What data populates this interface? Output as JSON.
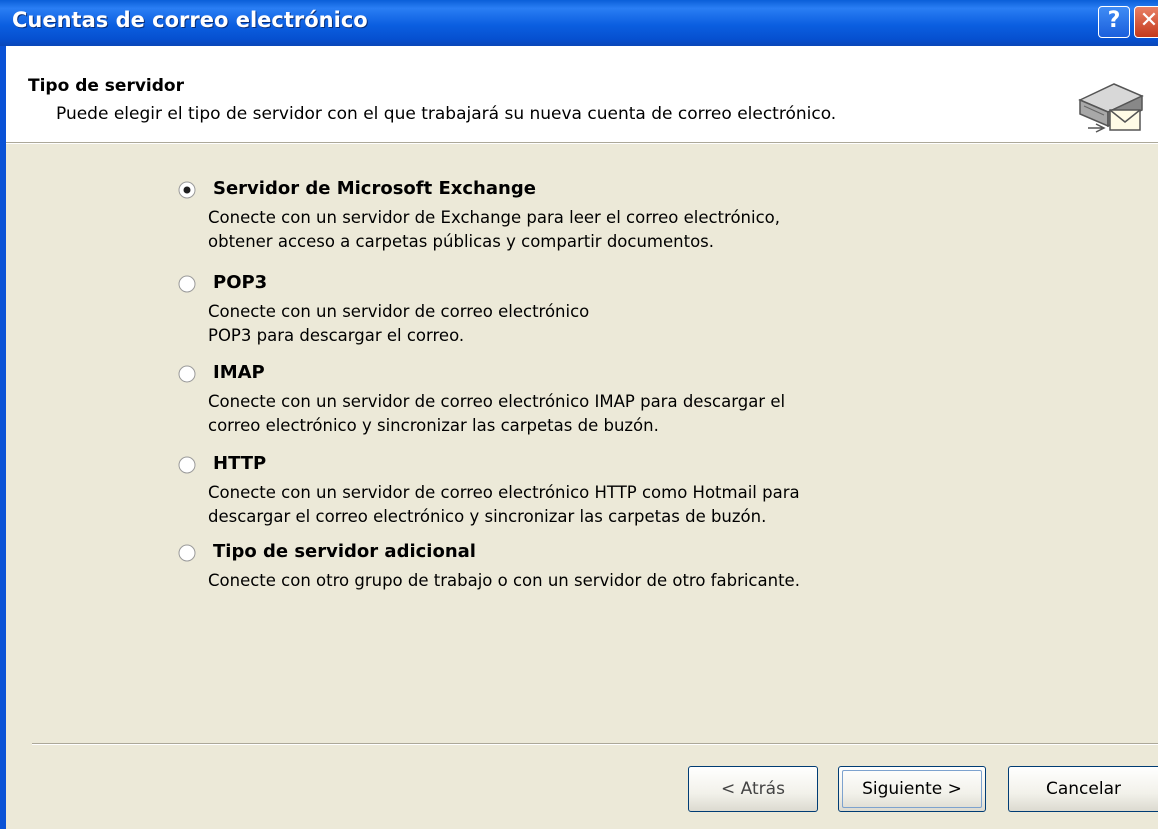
{
  "window": {
    "title": "Cuentas de correo electrónico",
    "help_glyph": "?",
    "close_glyph": "✕"
  },
  "header": {
    "title": "Tipo de servidor",
    "subtitle": "Puede elegir el tipo de servidor con el que trabajará su nueva cuenta de correo electrónico.",
    "icon": "mail-server-icon"
  },
  "options": [
    {
      "label": "Servidor de Microsoft Exchange",
      "selected": true,
      "desc1": "Conecte con un servidor de Exchange para leer el correo electrónico,",
      "desc2": "obtener acceso a carpetas públicas y compartir documentos."
    },
    {
      "label": "POP3",
      "selected": false,
      "desc1": "Conecte con un servidor de correo electrónico",
      "desc2": "POP3 para descargar el correo."
    },
    {
      "label": "IMAP",
      "selected": false,
      "desc1": "Conecte con un servidor de correo electrónico IMAP para descargar el",
      "desc2": "correo electrónico y sincronizar las carpetas de buzón."
    },
    {
      "label": "HTTP",
      "selected": false,
      "desc1": "Conecte con un servidor de correo electrónico HTTP como Hotmail para",
      "desc2": "descargar el correo electrónico y sincronizar las carpetas de buzón."
    },
    {
      "label": "Tipo de servidor adicional",
      "selected": false,
      "desc1": "Conecte con otro grupo de trabajo o con un servidor de otro fabricante."
    }
  ],
  "buttons": {
    "back": "< Atrás",
    "next": "Siguiente >",
    "cancel": "Cancelar"
  },
  "colors": {
    "titlebar": "#0a5fd8",
    "dialog_bg": "#ece9d8",
    "header_bg": "#ffffff"
  }
}
